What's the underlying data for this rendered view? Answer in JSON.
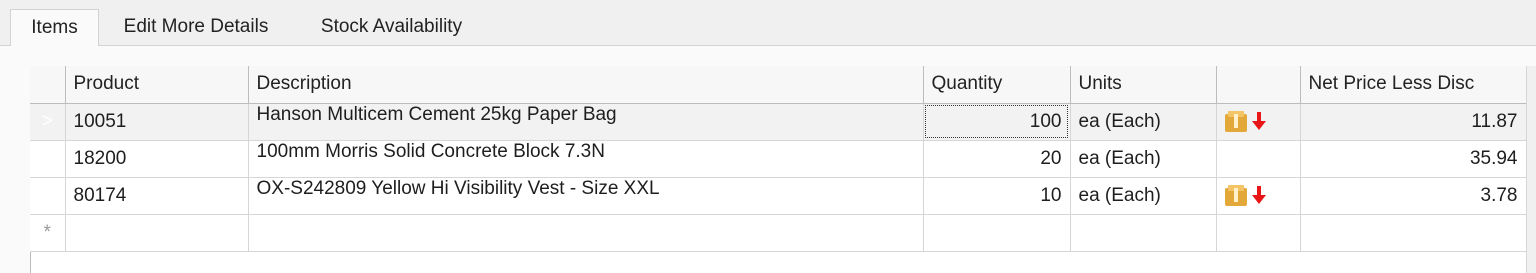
{
  "tabs": [
    {
      "label": "Items",
      "active": true
    },
    {
      "label": "Edit More Details",
      "active": false
    },
    {
      "label": "Stock Availability",
      "active": false
    }
  ],
  "grid": {
    "columns": {
      "product": "Product",
      "description": "Description",
      "quantity": "Quantity",
      "units": "Units",
      "stock": "",
      "net_price": "Net Price Less Disc"
    },
    "current_row_marker": ">",
    "new_row_marker": "*",
    "rows": [
      {
        "product": "10051",
        "description": "Hanson Multicem Cement 25kg Paper Bag",
        "quantity": "100",
        "units": "ea (Each)",
        "stock_icon": "box-down-icon",
        "net_price": "11.87"
      },
      {
        "product": "18200",
        "description": "100mm Morris Solid Concrete Block 7.3N",
        "quantity": "20",
        "units": "ea (Each)",
        "stock_icon": "",
        "net_price": "35.94"
      },
      {
        "product": "80174",
        "description": "OX-S242809 Yellow Hi Visibility Vest - Size XXL",
        "quantity": "10",
        "units": "ea (Each)",
        "stock_icon": "box-down-icon",
        "net_price": "3.78"
      }
    ]
  },
  "colors": {
    "current_row_marker_bg": "#a31515",
    "stock_arrow": "#e81616",
    "box": "#e2a93a"
  }
}
